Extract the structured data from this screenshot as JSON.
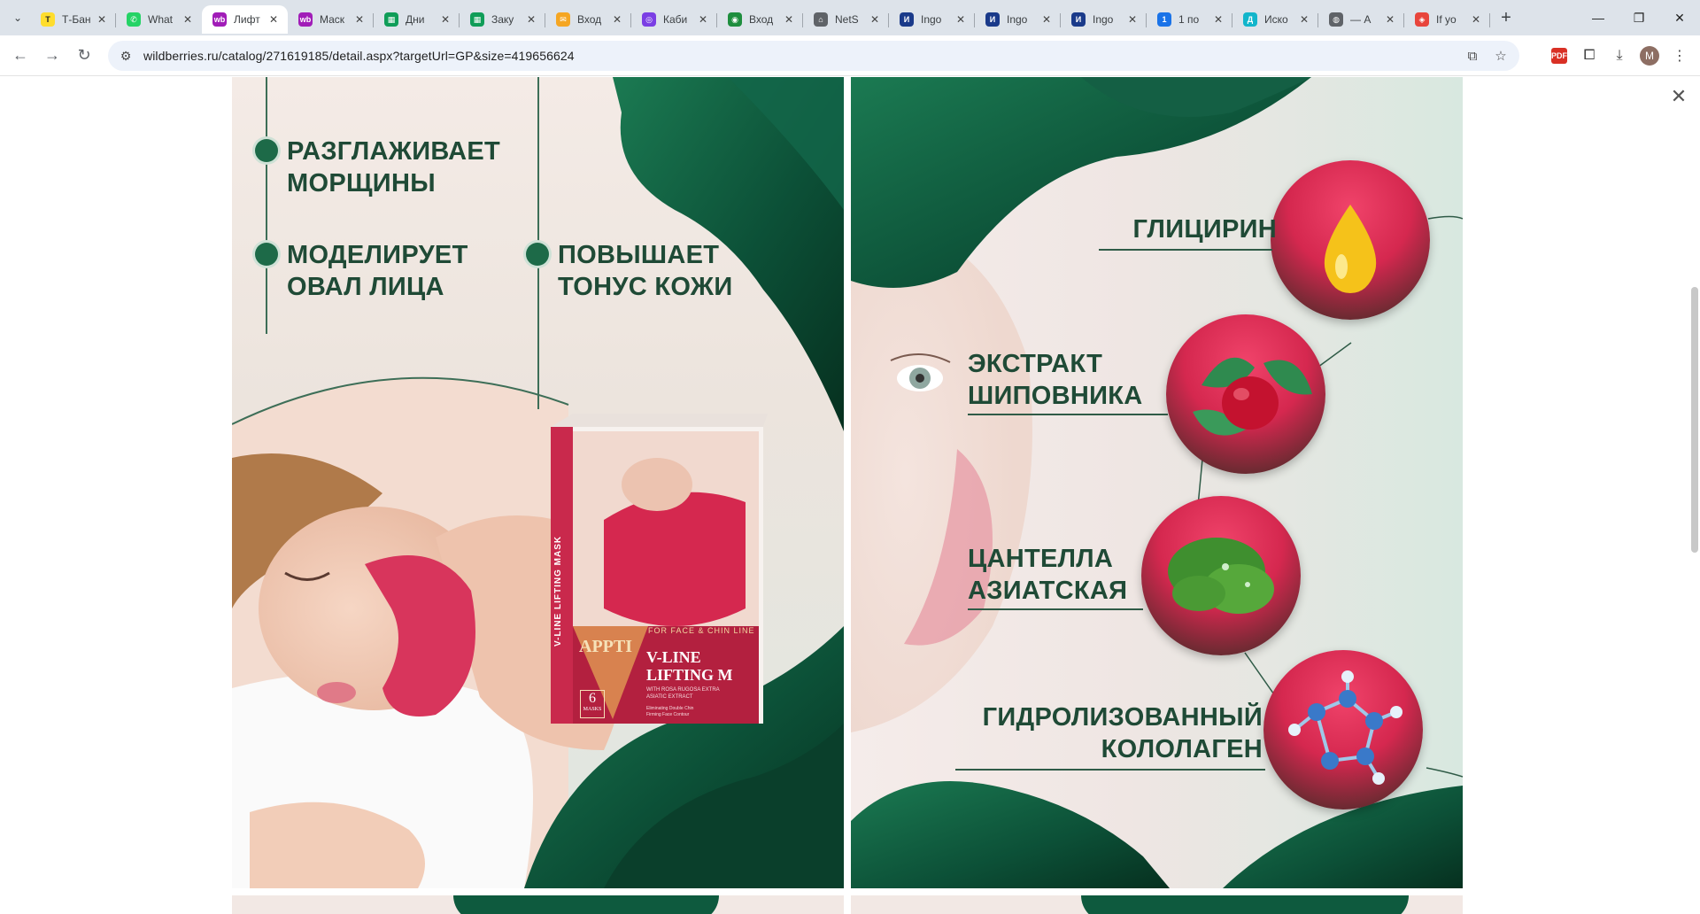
{
  "tabs": [
    {
      "title": "Т-Бан",
      "icon": "tbank-icon",
      "color": "#ffdd2d",
      "glyph": "Т"
    },
    {
      "title": "What",
      "icon": "whatsapp-icon",
      "color": "#25d366",
      "glyph": "✆"
    },
    {
      "title": "Лифт",
      "icon": "wildberries-icon",
      "color": "#a11db8",
      "glyph": "wb",
      "active": true
    },
    {
      "title": "Маск",
      "icon": "wildberries-icon",
      "color": "#a11db8",
      "glyph": "wb"
    },
    {
      "title": "Дни",
      "icon": "sheets-icon",
      "color": "#0f9d58",
      "glyph": "▦"
    },
    {
      "title": "Заку",
      "icon": "sheets-icon",
      "color": "#0f9d58",
      "glyph": "▦"
    },
    {
      "title": "Вход",
      "icon": "mail-icon",
      "color": "#f5a623",
      "glyph": "✉"
    },
    {
      "title": "Каби",
      "icon": "cabinet-icon",
      "color": "#7b3fe4",
      "glyph": "◎"
    },
    {
      "title": "Вход",
      "icon": "login-icon",
      "color": "#1e8e3e",
      "glyph": "◉"
    },
    {
      "title": "NetS",
      "icon": "nets-icon",
      "color": "#5f6368",
      "glyph": "⌂"
    },
    {
      "title": "Ingo",
      "icon": "ingo-icon",
      "color": "#1a3a8a",
      "glyph": "И"
    },
    {
      "title": "Ingo",
      "icon": "ingo-icon",
      "color": "#1a3a8a",
      "glyph": "И"
    },
    {
      "title": "Ingo",
      "icon": "ingo-icon",
      "color": "#1a3a8a",
      "glyph": "И"
    },
    {
      "title": "1 по",
      "icon": "one-icon",
      "color": "#1a73e8",
      "glyph": "1"
    },
    {
      "title": "Иско",
      "icon": "docs-icon",
      "color": "#12b5cb",
      "glyph": "Д"
    },
    {
      "title": "— А",
      "icon": "globe-icon",
      "color": "#5f6368",
      "glyph": "◍"
    },
    {
      "title": "If yo",
      "icon": "gift-icon",
      "color": "#e8453c",
      "glyph": "◈"
    }
  ],
  "address_bar": {
    "url": "wildberries.ru/catalog/271619185/detail.aspx?targetUrl=GP&size=419656624"
  },
  "left_panel": {
    "features": [
      {
        "line1": "РАЗГЛАЖИВАЕТ",
        "line2": "МОРЩИНЫ"
      },
      {
        "line1": "МОДЕЛИРУЕТ",
        "line2": "ОВАЛ ЛИЦА"
      },
      {
        "line1": "ПОВЫШАЕТ",
        "line2": "ТОНУС КОЖИ"
      }
    ],
    "box": {
      "brand_vertical": "V-LINE LIFTING MASK",
      "tagline": "FOR FACE & CHIN LINE",
      "brand": "APPTI",
      "title_line1": "V-LINE",
      "title_line2": "LIFTING M",
      "sub_line1": "WITH ROSA RUGOSA EXTRA",
      "sub_line2": "ASIATIC EXTRACT",
      "count": "6",
      "count_label": "MASKS",
      "small_line1": "Eliminating Double Chin",
      "small_line2": "Firming Face Contour"
    }
  },
  "right_panel": {
    "ingredients": [
      {
        "line1": "ГЛИЦИРИН",
        "line2": ""
      },
      {
        "line1": "ЭКСТРАКТ",
        "line2": "ШИПОВНИКА"
      },
      {
        "line1": "ЦАНТЕЛЛА",
        "line2": "АЗИАТСКАЯ"
      },
      {
        "line1": "ГИДРОЛИЗОВАННЫЙ",
        "line2": "КОЛОЛАГЕН"
      }
    ]
  },
  "colors": {
    "text_green": "#1f4a36",
    "accent_pink": "#d5284f",
    "leaf_green": "#0e5a3e"
  }
}
